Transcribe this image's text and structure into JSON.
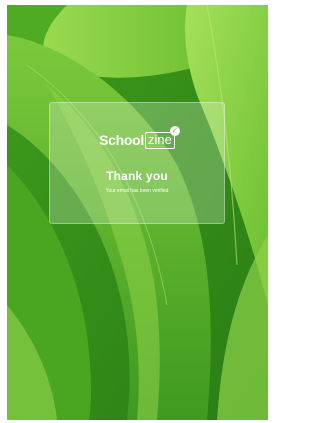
{
  "logo": {
    "part1": "School",
    "part2": "zine",
    "check_glyph": "✓"
  },
  "message": {
    "title": "Thank you",
    "subtitle": "Your email has been verified"
  },
  "colors": {
    "background_green": "#5fb82a",
    "leaf_light": "#8fd34a",
    "leaf_dark": "#2f8c1a",
    "text": "#ffffff"
  }
}
